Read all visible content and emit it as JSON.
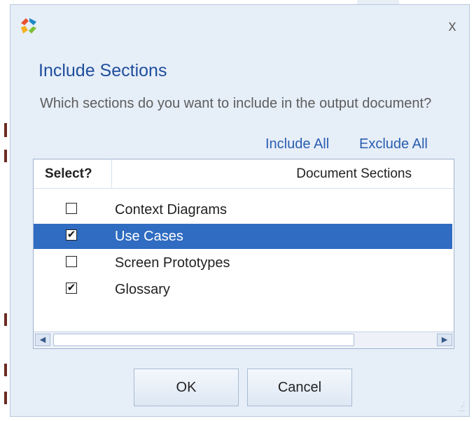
{
  "dialog": {
    "logo_icon": "app-logo-icon",
    "close_label": "x",
    "heading": "Include Sections",
    "question": "Which sections do you want to include in the output document?",
    "include_all": "Include All",
    "exclude_all": "Exclude All"
  },
  "grid": {
    "columns": [
      "Select?",
      "Document Sections"
    ],
    "rows": [
      {
        "label": "Context Diagrams",
        "checked": false,
        "selected": false
      },
      {
        "label": "Use Cases",
        "checked": true,
        "selected": true
      },
      {
        "label": "Screen Prototypes",
        "checked": false,
        "selected": false
      },
      {
        "label": "Glossary",
        "checked": true,
        "selected": false
      }
    ]
  },
  "buttons": {
    "ok": "OK",
    "cancel": "Cancel"
  },
  "colors": {
    "heading": "#1f4e9c",
    "link": "#2a5db0",
    "selection": "#2f6cc2",
    "dialog_bg": "#e6eef8"
  }
}
